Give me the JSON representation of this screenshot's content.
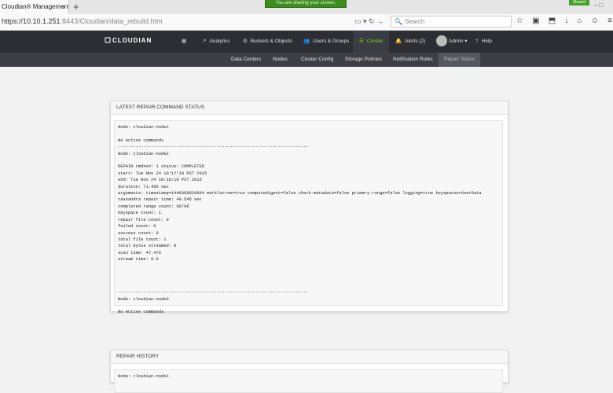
{
  "browser": {
    "tab_title": "Cloudian® Management ...",
    "tab_close": "×",
    "new_tab": "+",
    "sharing_banner": "You are sharing your screen.",
    "shared_badge": "Shared",
    "window_controls": "– □",
    "url_host": "https://10.10.1.251",
    "url_path": ":8443/Cloudian/data_rebuild.htm",
    "url_icons": "▭ ▾   ↻ →",
    "search_icon": "🔍",
    "search_placeholder": "Search",
    "toolbar_icons": [
      "☆",
      "▣",
      "⬒",
      "↓",
      "⌂",
      "☺",
      "≡"
    ]
  },
  "app": {
    "logo": "CLOUDIAN",
    "nav": {
      "dashboard_icon": "▦",
      "analytics": "Analytics",
      "analytics_icon": "↗",
      "buckets": "Buckets & Objects",
      "buckets_icon": "⚙",
      "users": "Users & Groups",
      "users_icon": "👥",
      "cluster": "Cluster",
      "cluster_icon": "☰",
      "alerts": "Alerts (2)",
      "alerts_icon": "🔔",
      "admin": "Admin ▾",
      "help": "Help",
      "help_icon": "?"
    },
    "subnav": [
      "Data Centers",
      "Nodes",
      "Cluster Config",
      "Storage Policies",
      "Notification Rules",
      "Repair Status"
    ]
  },
  "repair_status": {
    "title": "LATEST REPAIR COMMAND STATUS",
    "lines": [
      "Node: cloudian-node1",
      "",
      "No Active commands",
      "---------------------------------------------------------------------------",
      "Node: cloudian-node2",
      "",
      "REPAIR cmdno#: 1 status: COMPLETED",
      "start: Tue Nov 24 10:17:19 PST 2015",
      "end: Tue Nov 24 10:18:10 PST 2015",
      "duration: 71.455 sec",
      "arguments: timestamp=1448389820094 merkletree=true computedigest=false check-metadata=false primary-range=false logging=true keyspaces=UserData",
      "cassandra repair time: 49.545 sec",
      "completed range count: 96/96",
      "keyspace count: 1",
      "repair file count: 0",
      "failed count: 0",
      "success count: 0",
      "total file count: 1",
      "total bytes streamed: 0",
      "scan time: 47.476",
      "stream time: 0.0",
      "",
      "",
      "",
      "",
      "---------------------------------------------------------------------------",
      "Node: cloudian-node3",
      "",
      "No Active commands"
    ]
  },
  "repair_history": {
    "title": "REPAIR HISTORY",
    "lines": [
      "Node: cloudian-node1"
    ]
  }
}
